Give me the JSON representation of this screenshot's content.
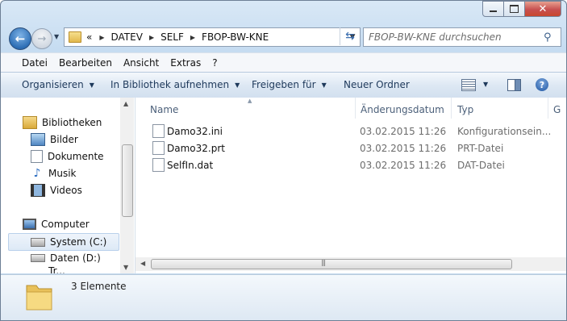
{
  "window": {
    "close_label": "✕"
  },
  "address": {
    "overflow": "«",
    "crumbs": [
      "DATEV",
      "SELF",
      "FBOP-BW-KNE"
    ]
  },
  "search": {
    "placeholder": "FBOP-BW-KNE durchsuchen"
  },
  "menu": [
    "Datei",
    "Bearbeiten",
    "Ansicht",
    "Extras",
    "?"
  ],
  "toolbar": {
    "organize": "Organisieren",
    "library": "In Bibliothek aufnehmen",
    "share": "Freigeben für",
    "new_folder": "Neuer Ordner",
    "help": "?"
  },
  "nav": {
    "libraries": "Bibliotheken",
    "items": [
      "Bilder",
      "Dokumente",
      "Musik",
      "Videos"
    ],
    "computer": "Computer",
    "drives": [
      "System (C:)",
      "Daten (D:)"
    ],
    "partial": "Tr..."
  },
  "columns": [
    "Name",
    "Änderungsdatum",
    "Typ",
    "G"
  ],
  "files": [
    {
      "name": "Damo32.ini",
      "date": "03.02.2015 11:26",
      "type": "Konfigurationsein..."
    },
    {
      "name": "Damo32.prt",
      "date": "03.02.2015 11:26",
      "type": "PRT-Datei"
    },
    {
      "name": "SelfIn.dat",
      "date": "03.02.2015 11:26",
      "type": "DAT-Datei"
    }
  ],
  "status": {
    "count": "3 Elemente"
  }
}
